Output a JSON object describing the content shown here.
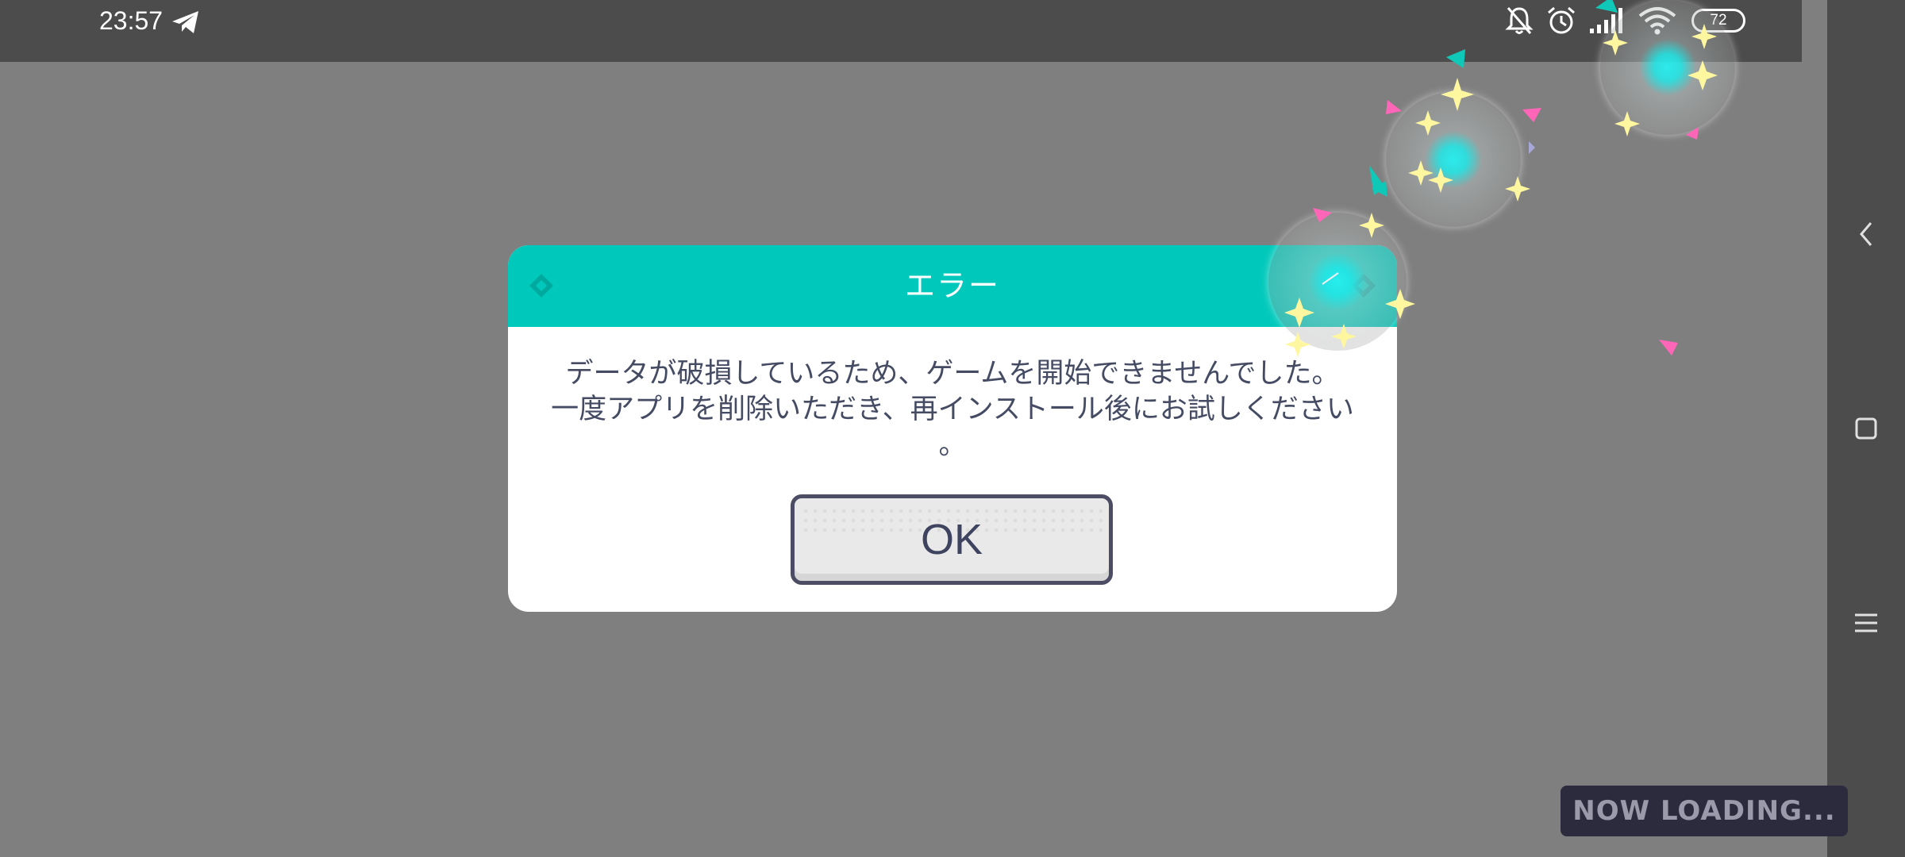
{
  "status_bar": {
    "time": "23:57",
    "battery_level": "72",
    "icons": [
      "telegram-icon",
      "bell-muted-icon",
      "alarm-icon",
      "signal-icon",
      "wifi-icon",
      "battery-icon"
    ]
  },
  "dialog": {
    "title": "エラー",
    "message_lines": [
      "データが破損しているため、ゲームを開始できませんでした。",
      "一度アプリを削除いただき、再インストール後にお試しください",
      "。"
    ],
    "ok_label": "OK"
  },
  "loading": {
    "text": "NOW LOADING..."
  },
  "nav_bar": {
    "icons": [
      "back-chevron-icon",
      "home-square-icon",
      "menu-lines-icon"
    ]
  },
  "colors": {
    "header_teal": "#00c9bb",
    "overlay_gray": "#7f7f7f",
    "system_bar": "#4c4c4c",
    "text_navy": "#444b63",
    "bubble_cyan": "#28f0f0"
  }
}
